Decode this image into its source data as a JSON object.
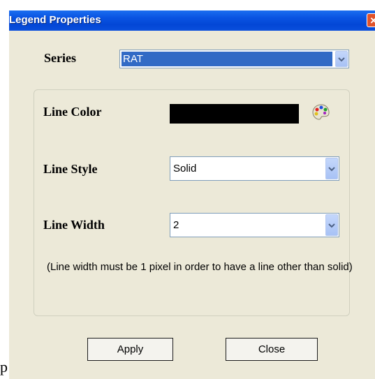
{
  "window": {
    "title": "Legend Properties"
  },
  "series": {
    "label": "Series",
    "value": "RAT"
  },
  "line_color": {
    "label": "Line Color",
    "swatch_color": "#000000",
    "icon": "palette-icon"
  },
  "line_style": {
    "label": "Line Style",
    "value": "Solid"
  },
  "line_width": {
    "label": "Line Width",
    "value": "2"
  },
  "hint": "(Line width must be 1 pixel in order to have a line other than solid)",
  "buttons": {
    "apply": "Apply",
    "close": "Close"
  },
  "page": {
    "stray_text": "p"
  }
}
